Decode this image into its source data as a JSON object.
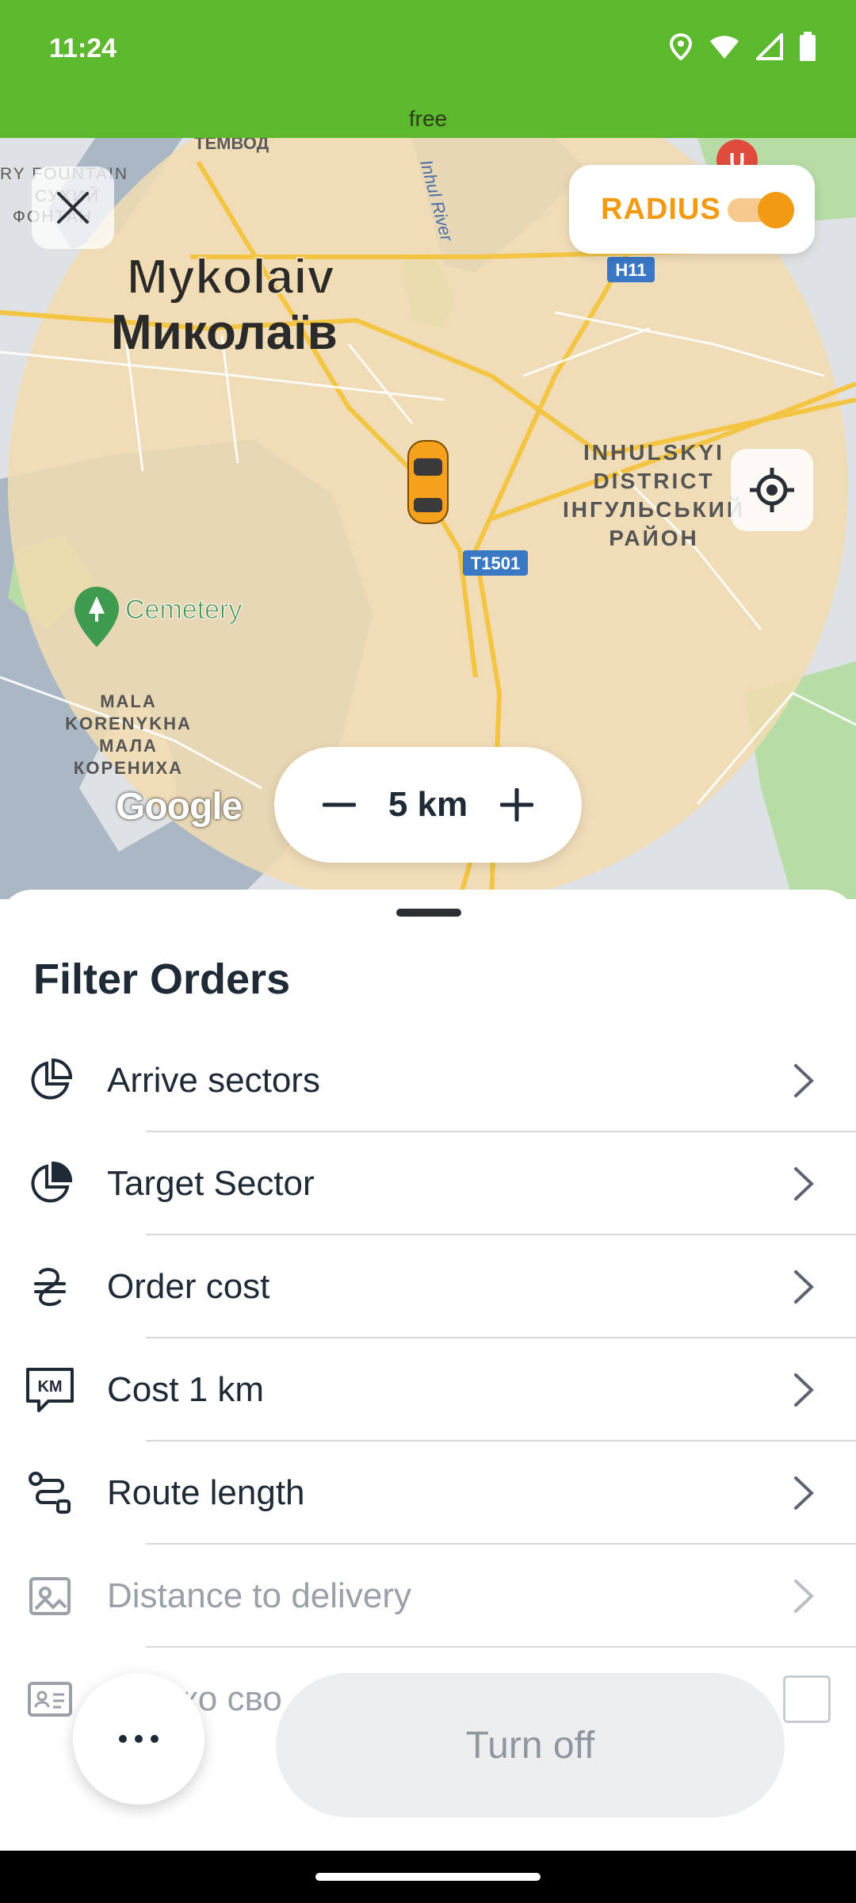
{
  "status_bar": {
    "time": "11:24"
  },
  "banner": {
    "text": "free"
  },
  "map": {
    "city_en": "Mykolaiv",
    "city_uk": "Миколаїв",
    "district_lines": [
      "INHULSKYI",
      "DISTRICT",
      "ІНГУЛЬСЬКИЙ",
      "РАЙОН"
    ],
    "poi_cemetery": "Cemetery",
    "area_lines": [
      "MALA",
      "KORENYKHA",
      "МАЛА",
      "КОРЕНИХА"
    ],
    "river": "Inhul River",
    "road_h11": "H11",
    "road_t1501": "T1501",
    "top_left_fragments": [
      "RY FOUNTAIN",
      "СУХИЙ",
      "ФОНТАН"
    ],
    "top_fragment": "ТЕМВОД",
    "logo": "Google"
  },
  "controls": {
    "radius_label": "RADIUS",
    "radius_on": true,
    "zoom_value": "5 km"
  },
  "sheet": {
    "title": "Filter Orders",
    "items": [
      {
        "label": "Arrive sectors",
        "icon": "pie-sector-icon",
        "disabled": false
      },
      {
        "label": "Target Sector",
        "icon": "pie-filled-sector-icon",
        "disabled": false
      },
      {
        "label": "Order cost",
        "icon": "hryvnia-icon",
        "disabled": false
      },
      {
        "label": "Cost 1 km",
        "icon": "km-chat-icon",
        "disabled": false
      },
      {
        "label": "Route length",
        "icon": "route-icon",
        "disabled": false
      },
      {
        "label": "Distance to delivery",
        "icon": "map-pin-card-icon",
        "disabled": true
      },
      {
        "label": "ко сво",
        "icon": "id-card-icon",
        "disabled": true
      }
    ],
    "turn_off": "Turn off"
  },
  "colors": {
    "status_green": "#5cb82c",
    "accent_orange": "#f29b12",
    "radius_fill": "#f3dcb0"
  }
}
